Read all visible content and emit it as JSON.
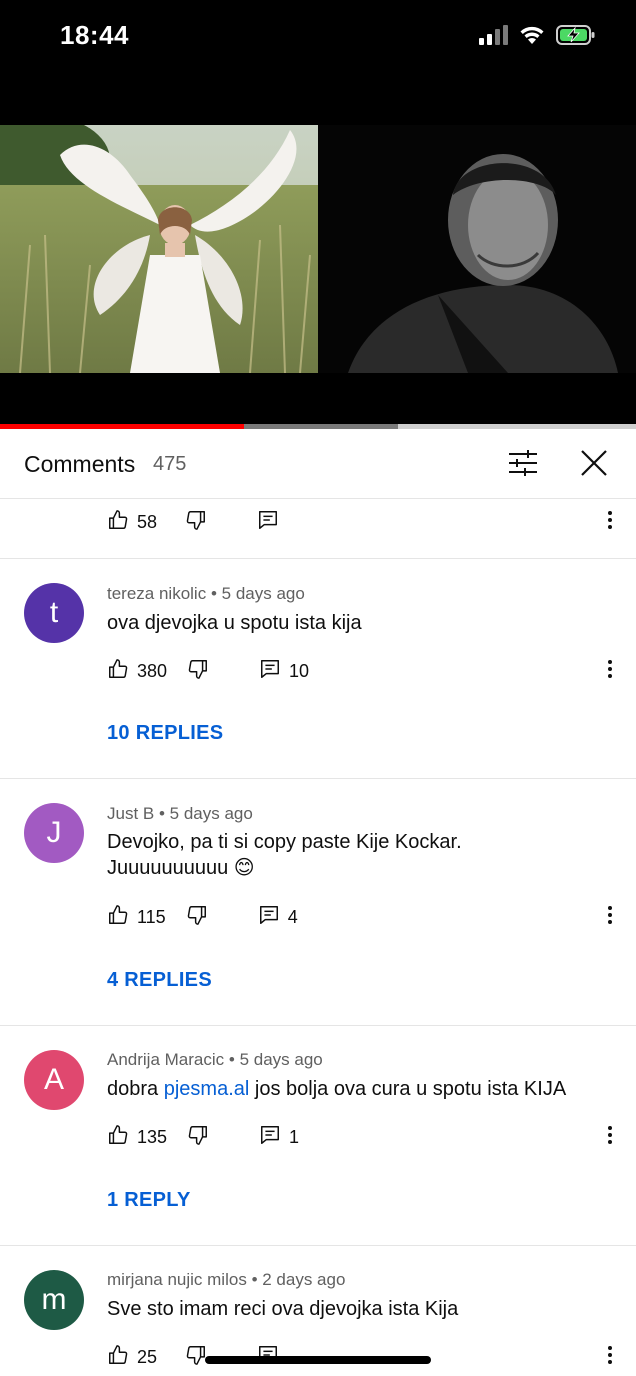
{
  "status_bar": {
    "time": "18:44"
  },
  "comments_panel": {
    "title": "Comments",
    "count": "475"
  },
  "top_partial_comment": {
    "likes": "58"
  },
  "comments": [
    {
      "avatar_letter": "t",
      "avatar_color": "#5533a8",
      "author": "tereza nikolic",
      "time": "5 days ago",
      "text": "ova djevojka u spotu ista kija",
      "likes": "380",
      "reply_count": "10",
      "replies_label": "10 REPLIES"
    },
    {
      "avatar_letter": "J",
      "avatar_color": "#a25ac2",
      "author": "Just B",
      "time": "5 days ago",
      "text_line1": "Devojko, pa ti si copy paste Kije Kockar.",
      "text_line2": "Juuuuuuuuuu 😊",
      "likes": "115",
      "reply_count": "4",
      "replies_label": "4 REPLIES"
    },
    {
      "avatar_letter": "A",
      "avatar_color": "#e0486f",
      "author": "Andrija Maracic",
      "time": "5 days ago",
      "text_before": "dobra ",
      "text_link": "pjesma.al",
      "text_after": " jos bolja ova cura u spotu ista KIJA",
      "likes": "135",
      "reply_count": "1",
      "replies_label": "1 REPLY"
    },
    {
      "avatar_letter": "m",
      "avatar_color": "#1e5a45",
      "author": "mirjana nujic milos",
      "time": "2 days ago",
      "text": "Sve sto imam reci ova djevojka ista Kija",
      "likes": "25"
    }
  ],
  "video": {
    "progress_played": 0.384,
    "progress_buffered": 0.625
  },
  "icons": [
    "signal-icon",
    "wifi-icon",
    "battery-charging-icon",
    "filter-icon",
    "close-icon",
    "like-icon",
    "dislike-icon",
    "reply-icon",
    "more-vertical-icon"
  ]
}
